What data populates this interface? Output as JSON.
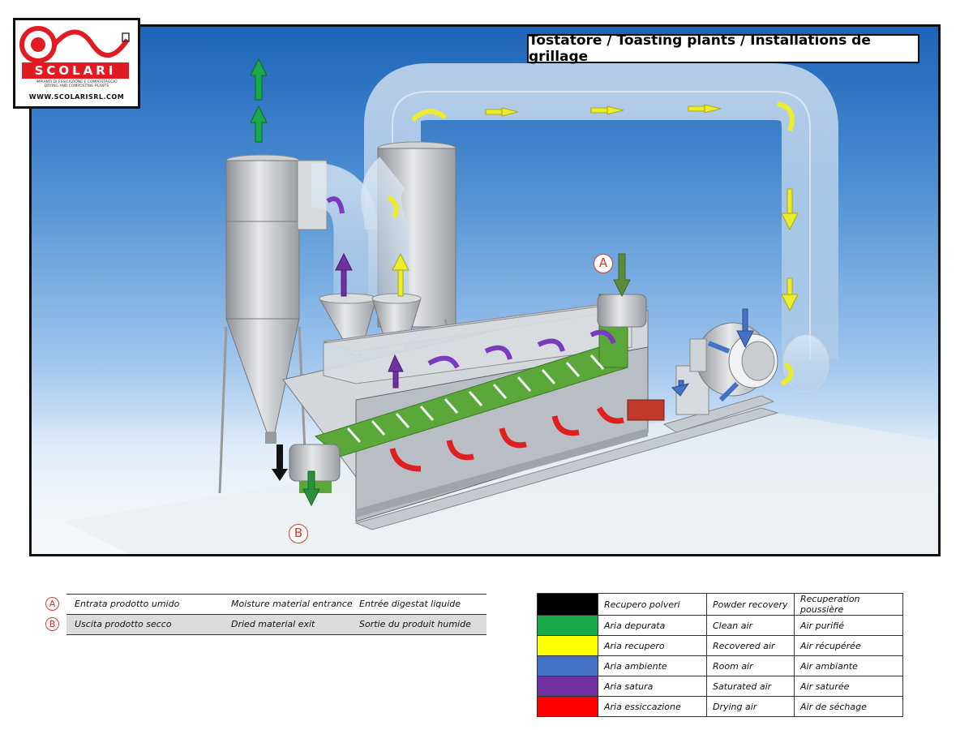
{
  "title": "Tostatore / Toasting plants / Installations de grillage",
  "logo": {
    "name": "SCOLARI",
    "subtitle_1": "IMPIANTI DI ESSICAZIONE E COMPOSTAGGIO",
    "subtitle_2": "DRYING AND COMPOSTING PLANTS",
    "website": "WWW.SCOLARISRL.COM",
    "brand_color": "#e11b22"
  },
  "diagram_markers": {
    "a": "A",
    "b": "B"
  },
  "material_legend": [
    {
      "marker": "A",
      "it": "Entrata prodotto umido",
      "en": "Moisture material entrance",
      "fr": "Entrée digestat liquide"
    },
    {
      "marker": "B",
      "it": "Uscita prodotto secco",
      "en": "Dried material exit",
      "fr": "Sortie du produit humide"
    }
  ],
  "color_legend": [
    {
      "color": "#000000",
      "it": "Recupero polveri",
      "en": "Powder recovery",
      "fr": "Recuperation poussière"
    },
    {
      "color": "#1aa84a",
      "it": "Aria depurata",
      "en": "Clean air",
      "fr": "Air purifié"
    },
    {
      "color": "#ffff00",
      "it": "Aria recupero",
      "en": "Recovered air",
      "fr": "Air récupérée"
    },
    {
      "color": "#4472c4",
      "it": "Aria ambiente",
      "en": "Room air",
      "fr": "Air ambiante"
    },
    {
      "color": "#7030a0",
      "it": "Aria satura",
      "en": "Saturated air",
      "fr": "Air saturée"
    },
    {
      "color": "#ff0000",
      "it": "Aria essiccazione",
      "en": "Drying air",
      "fr": "Air de séchage"
    }
  ]
}
